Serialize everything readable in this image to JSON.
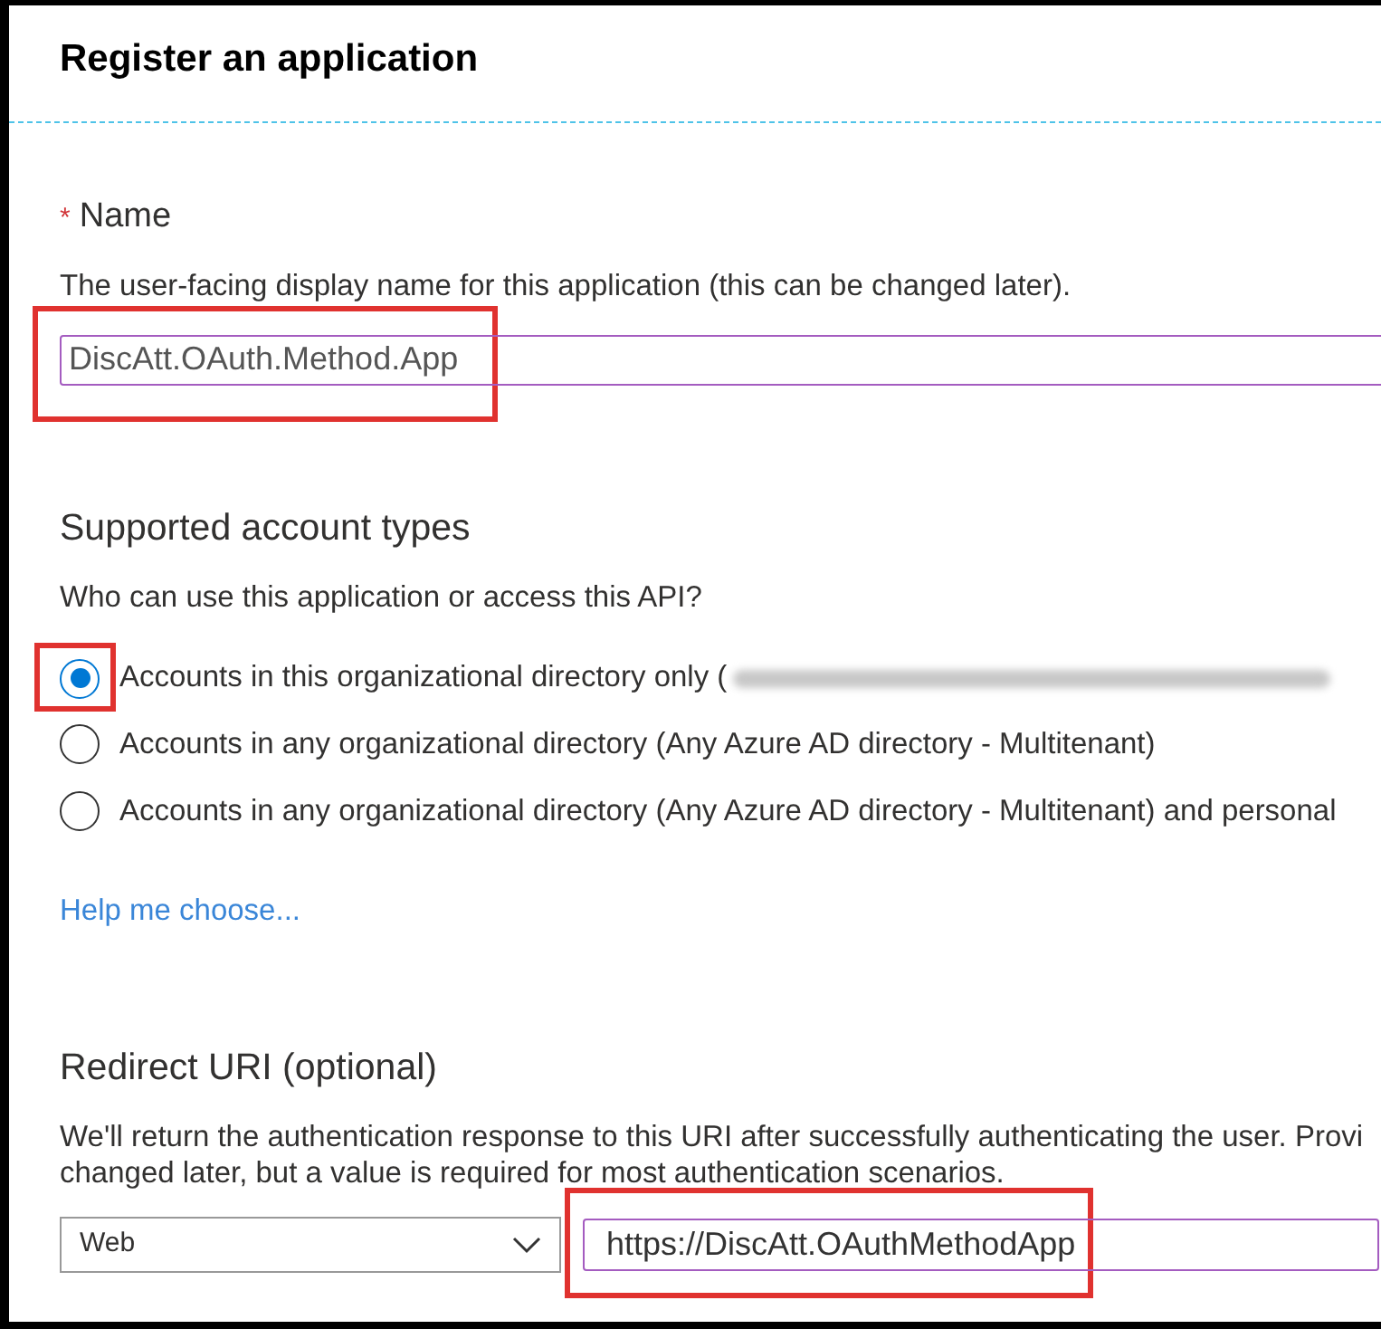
{
  "title": "Register an application",
  "name_section": {
    "required_mark": "*",
    "label": "Name",
    "description": "The user-facing display name for this application (this can be changed later).",
    "value": "DiscAtt.OAuth.Method.App",
    "highlighted": true
  },
  "account_types": {
    "heading": "Supported account types",
    "question": "Who can use this application or access this API?",
    "options": [
      {
        "label": "Accounts in this organizational directory only (",
        "selected": true,
        "highlighted": true,
        "redacted": true
      },
      {
        "label": "Accounts in any organizational directory (Any Azure AD directory - Multitenant)",
        "selected": false,
        "highlighted": false,
        "redacted": false
      },
      {
        "label": "Accounts in any organizational directory (Any Azure AD directory - Multitenant) and personal",
        "selected": false,
        "highlighted": false,
        "redacted": false
      }
    ],
    "help_link": "Help me choose..."
  },
  "redirect": {
    "heading": "Redirect URI (optional)",
    "description": [
      "We'll return the authentication response to this URI after successfully authenticating the user. Provi",
      "changed later, but a value is required for most authentication scenarios."
    ],
    "platform": "Web",
    "uri": "https://DiscAtt.OAuthMethodApp",
    "highlighted": true
  }
}
